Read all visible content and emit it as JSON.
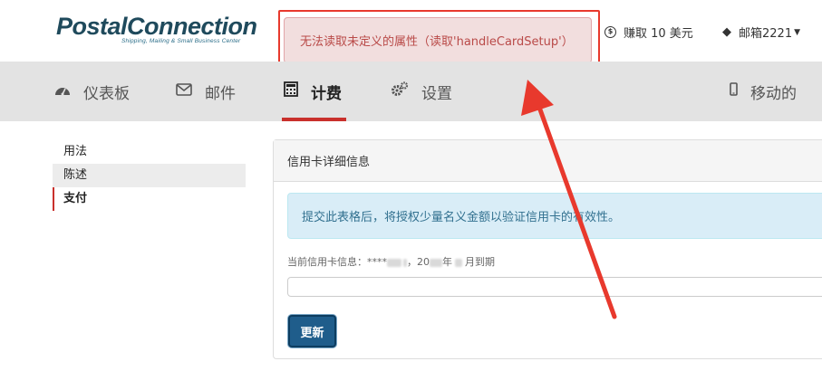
{
  "header": {
    "logo_text": "PostalConnection",
    "logo_tagline": "Shipping, Mailing & Small Business Center",
    "error_message": "无法读取未定义的属性（读取'handleCardSetup'）",
    "earn_label": "赚取 10 美元",
    "mailbox_label": "邮箱2221"
  },
  "nav": {
    "items": [
      {
        "label": "仪表板",
        "icon": "dashboard-icon"
      },
      {
        "label": "邮件",
        "icon": "envelope-icon"
      },
      {
        "label": "计费",
        "icon": "calculator-icon",
        "active": true
      },
      {
        "label": "设置",
        "icon": "gears-icon"
      },
      {
        "label": "移动的",
        "icon": "mobile-icon"
      }
    ]
  },
  "side_menu": {
    "items": [
      {
        "label": "用法"
      },
      {
        "label": "陈述"
      },
      {
        "label": "支付",
        "active": true
      }
    ]
  },
  "panel": {
    "title": "信用卡详细信息",
    "info_text": "提交此表格后，将授权少量名义金额以验证信用卡的有效性。",
    "current_card_prefix": "当前信用卡信息：****",
    "current_card_mid": "，20",
    "current_card_year": "年",
    "current_card_suffix": "月到期",
    "card_input_value": "",
    "update_button": "更新"
  },
  "colors": {
    "accent_red": "#c9302c",
    "annotation_red": "#e8392d",
    "button_blue": "#1f5d8b",
    "brand": "#1f4a5c"
  }
}
